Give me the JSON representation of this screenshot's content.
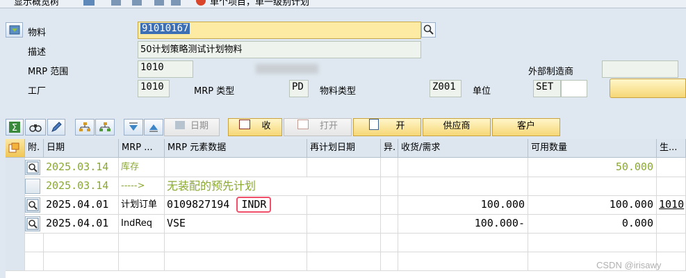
{
  "top_toolbar": {
    "items": [
      "显示概览树",
      "单个项目，单一级别计划"
    ]
  },
  "header": {
    "material_label": "物料",
    "material_value": "91010167",
    "desc_label": "描述",
    "desc_value": "50计划策略测试计划物料",
    "mrp_area_label": "MRP 范围",
    "mrp_area_value": "1010",
    "plant_label": "工厂",
    "plant_value": "1010",
    "mrp_type_label": "MRP 类型",
    "mrp_type_value": "PD",
    "mat_type_label": "物料类型",
    "mat_type_value": "Z001",
    "unit_label": "单位",
    "unit_value": "SET",
    "ext_proc_label": "外部制造商"
  },
  "toolbar2": {
    "date_btn": "日期",
    "collect_btn": "收",
    "open_btn": "打开",
    "open2_btn": "开",
    "supplier_btn": "供应商",
    "customer_btn": "客户"
  },
  "table": {
    "columns": [
      "附.",
      "日期",
      "MRP ...",
      "MRP 元素数据",
      "再计划日期",
      "异.",
      "收货/需求",
      "可用数量",
      "生..."
    ],
    "rows": [
      {
        "date": "2025.03.14",
        "elem": "库存",
        "data": "",
        "rec": "",
        "avail": "50.000",
        "prod": ""
      },
      {
        "date": "2025.03.14",
        "elem": "----->",
        "data": "无装配的预先计划",
        "rec": "",
        "avail": "",
        "prod": ""
      },
      {
        "date": "2025.04.01",
        "elem": "计划订单",
        "data": "0109827194",
        "data2": "INDR",
        "rec": "100.000",
        "avail": "100.000",
        "prod": "1010"
      },
      {
        "date": "2025.04.01",
        "elem": "IndReq",
        "data": "VSE",
        "rec": "100.000-",
        "avail": "0.000",
        "prod": ""
      }
    ]
  },
  "watermark": "CSDN @irisawy"
}
